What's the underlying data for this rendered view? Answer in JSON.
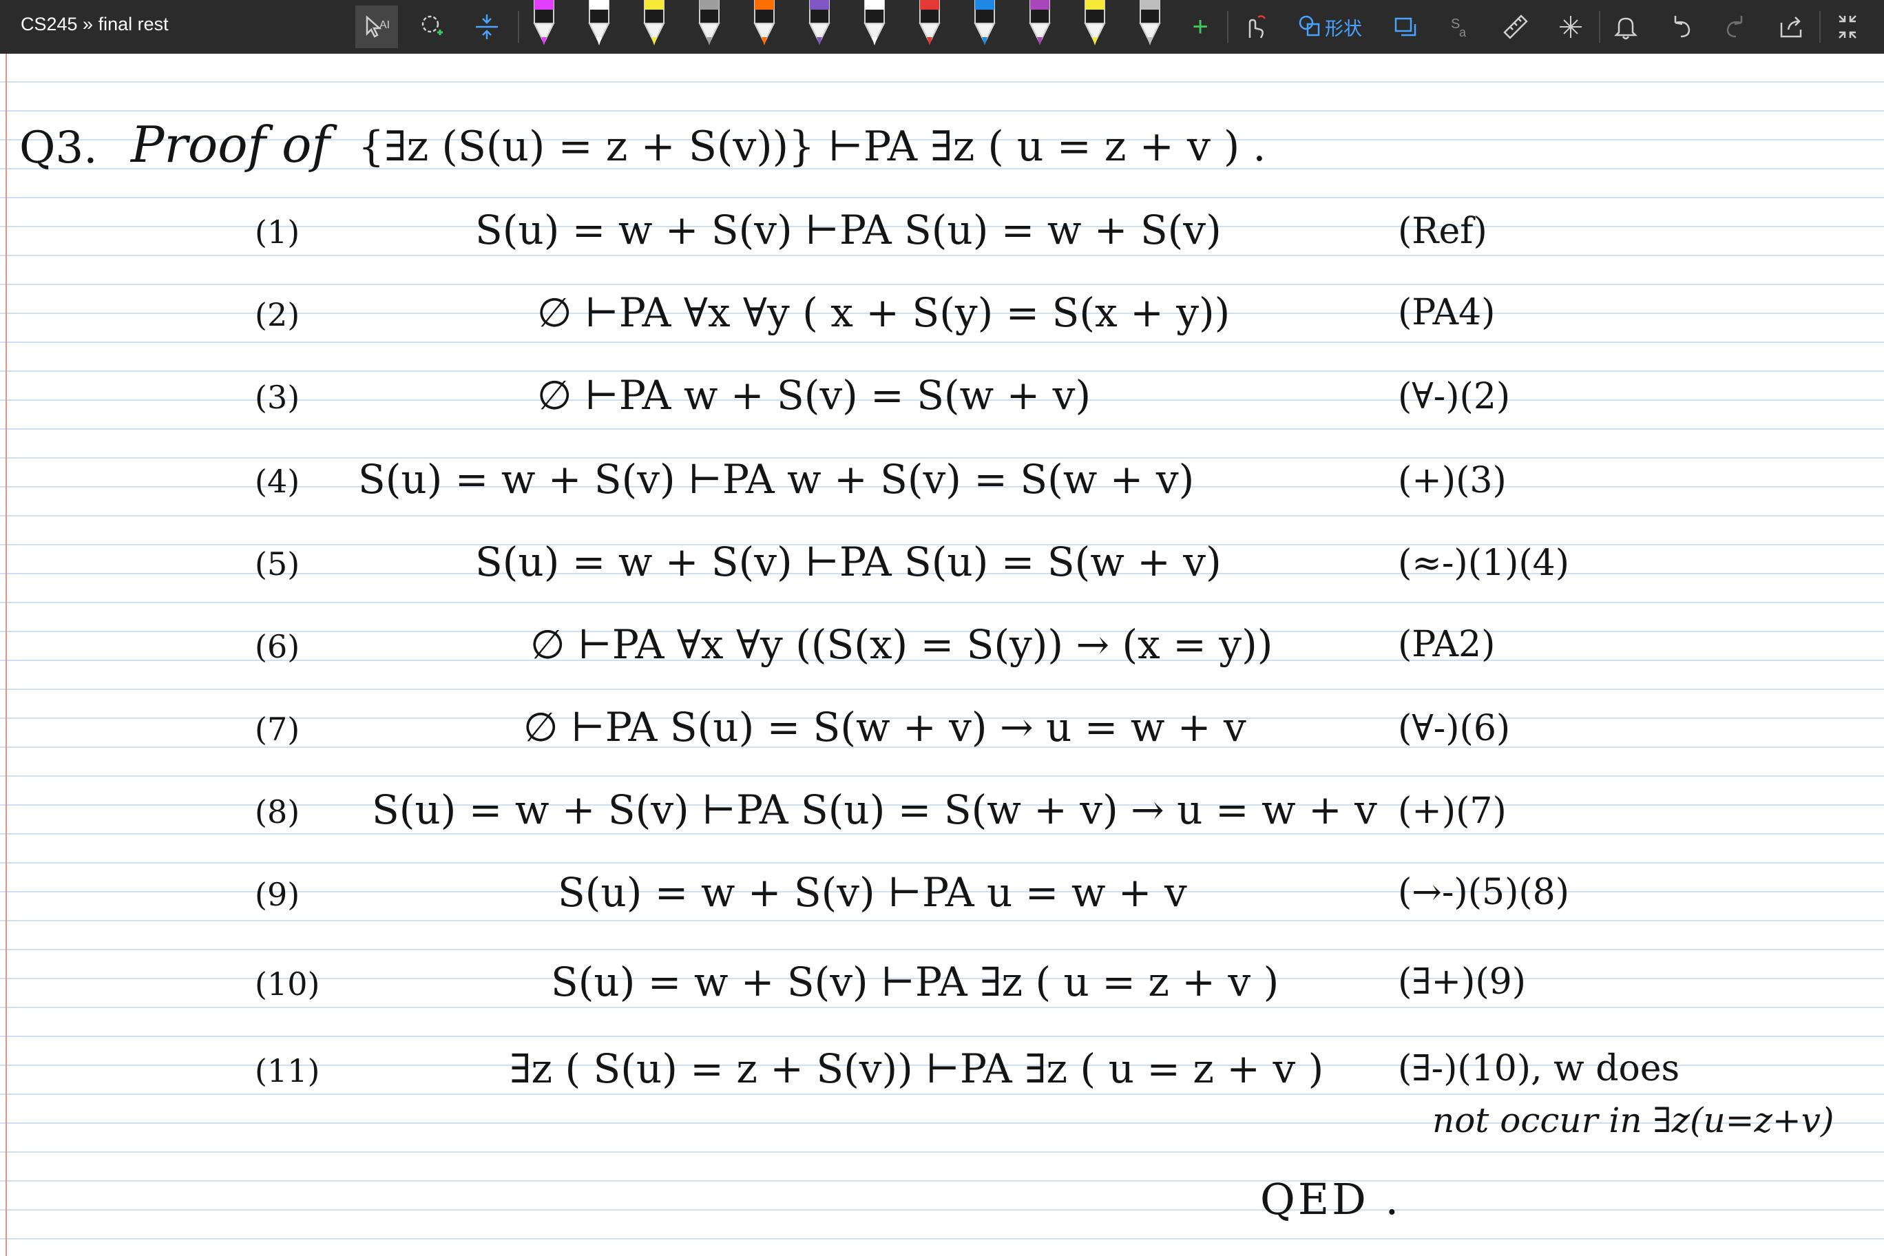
{
  "header": {
    "breadcrumb": "CS245 » final rest",
    "shape_label": "形状"
  },
  "toolbar": {
    "icons": [
      "text-select-icon",
      "lasso-select-icon",
      "add-space-icon",
      "pen-icon",
      "ruler-icon",
      "eraser-icon",
      "hand-icon",
      "shape-icon",
      "ink-to-shape-icon",
      "ink-to-math-icon",
      "ruler-tool-icon",
      "protractor-icon",
      "notification-icon",
      "undo-icon",
      "redo-icon",
      "share-icon",
      "fullscreen-icon"
    ],
    "pen_colors": [
      "#e040fb",
      "#ffffff",
      "#f6e93a",
      "#9e9e9e",
      "#ff6f00",
      "#7e57c2",
      "#ffffff",
      "#e53935",
      "#1e88e5",
      "#ab47bc",
      "#f6e93a",
      "#bdbdbd"
    ]
  },
  "notes": {
    "title": {
      "q": "Q3.",
      "proof": "Proof of",
      "statement": "{∃z (S(u) = z + S(v))} ⊢PA ∃z ( u = z + v ) ."
    },
    "lines": [
      {
        "num": "(1)",
        "expr": "S(u) = w + S(v) ⊢PA S(u) = w + S(v)",
        "rule": "(Ref)"
      },
      {
        "num": "(2)",
        "expr": "∅ ⊢PA ∀x ∀y ( x + S(y) = S(x + y))",
        "rule": "(PA4)"
      },
      {
        "num": "(3)",
        "expr": "∅ ⊢PA w + S(v) = S(w + v)",
        "rule": "(∀-)(2)"
      },
      {
        "num": "(4)",
        "expr": "S(u) = w + S(v) ⊢PA w + S(v) = S(w + v)",
        "rule": "(+)(3)"
      },
      {
        "num": "(5)",
        "expr": "S(u) = w + S(v) ⊢PA S(u) = S(w + v)",
        "rule": "(≈-)(1)(4)"
      },
      {
        "num": "(6)",
        "expr": "∅ ⊢PA ∀x ∀y ((S(x) = S(y)) → (x = y))",
        "rule": "(PA2)"
      },
      {
        "num": "(7)",
        "expr": "∅ ⊢PA S(u) = S(w + v) → u = w + v",
        "rule": "(∀-)(6)"
      },
      {
        "num": "(8)",
        "expr": "S(u) = w + S(v) ⊢PA S(u) = S(w + v) → u = w + v",
        "rule": "(+)(7)"
      },
      {
        "num": "(9)",
        "expr": "S(u) = w + S(v) ⊢PA u = w + v",
        "rule": "(→-)(5)(8)"
      },
      {
        "num": "(10)",
        "expr": "S(u) = w + S(v) ⊢PA ∃z ( u = z + v )",
        "rule": "(∃+)(9)"
      },
      {
        "num": "(11)",
        "expr": "∃z ( S(u) = z + S(v)) ⊢PA ∃z ( u = z + v )",
        "rule": "(∃-)(10), w does"
      }
    ],
    "note": "not occur in ∃z(u=z+v)",
    "qed": "QED ."
  }
}
